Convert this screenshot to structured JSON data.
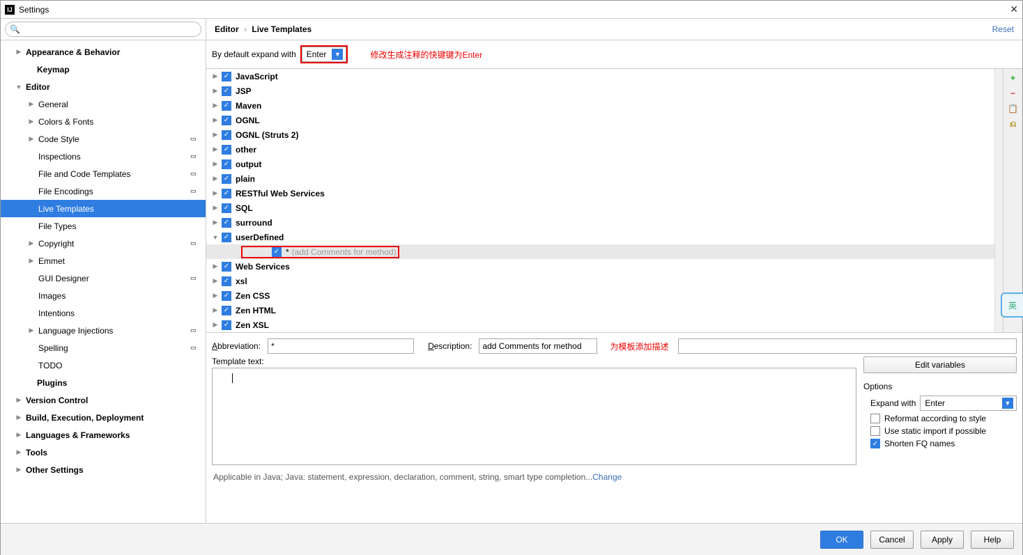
{
  "window": {
    "title": "Settings",
    "close": "✕"
  },
  "search": {
    "placeholder": ""
  },
  "breadcrumb": {
    "a": "Editor",
    "b": "Live Templates",
    "reset": "Reset"
  },
  "sidebar": [
    {
      "lbl": "Appearance & Behavior",
      "ind": 16,
      "arr": "▶",
      "b": 1
    },
    {
      "lbl": "Keymap",
      "ind": 32,
      "noarr": 1,
      "b": 1
    },
    {
      "lbl": "Editor",
      "ind": 16,
      "arr": "▼",
      "b": 1
    },
    {
      "lbl": "General",
      "ind": 34,
      "arr": "▶"
    },
    {
      "lbl": "Colors & Fonts",
      "ind": 34,
      "arr": "▶"
    },
    {
      "lbl": "Code Style",
      "ind": 34,
      "arr": "▶",
      "tag": 1
    },
    {
      "lbl": "Inspections",
      "ind": 34,
      "noarr": 1,
      "tag": 1
    },
    {
      "lbl": "File and Code Templates",
      "ind": 34,
      "noarr": 1,
      "tag": 1
    },
    {
      "lbl": "File Encodings",
      "ind": 34,
      "noarr": 1,
      "tag": 1
    },
    {
      "lbl": "Live Templates",
      "ind": 34,
      "noarr": 1,
      "sel": 1
    },
    {
      "lbl": "File Types",
      "ind": 34,
      "noarr": 1
    },
    {
      "lbl": "Copyright",
      "ind": 34,
      "arr": "▶",
      "tag": 1
    },
    {
      "lbl": "Emmet",
      "ind": 34,
      "arr": "▶"
    },
    {
      "lbl": "GUI Designer",
      "ind": 34,
      "noarr": 1,
      "tag": 1
    },
    {
      "lbl": "Images",
      "ind": 34,
      "noarr": 1
    },
    {
      "lbl": "Intentions",
      "ind": 34,
      "noarr": 1
    },
    {
      "lbl": "Language Injections",
      "ind": 34,
      "arr": "▶",
      "tag": 1
    },
    {
      "lbl": "Spelling",
      "ind": 34,
      "noarr": 1,
      "tag": 1
    },
    {
      "lbl": "TODO",
      "ind": 34,
      "noarr": 1
    },
    {
      "lbl": "Plugins",
      "ind": 32,
      "noarr": 1,
      "b": 1
    },
    {
      "lbl": "Version Control",
      "ind": 16,
      "arr": "▶",
      "b": 1
    },
    {
      "lbl": "Build, Execution, Deployment",
      "ind": 16,
      "arr": "▶",
      "b": 1
    },
    {
      "lbl": "Languages & Frameworks",
      "ind": 16,
      "arr": "▶",
      "b": 1
    },
    {
      "lbl": "Tools",
      "ind": 16,
      "arr": "▶",
      "b": 1
    },
    {
      "lbl": "Other Settings",
      "ind": 16,
      "arr": "▶",
      "b": 1
    }
  ],
  "expand": {
    "label": "By default expand with",
    "value": "Enter",
    "anno": "修改生成注释的快键键为Enter"
  },
  "tree": [
    {
      "lbl": "JavaScript",
      "arr": "▶"
    },
    {
      "lbl": "JSP",
      "arr": "▶"
    },
    {
      "lbl": "Maven",
      "arr": "▶"
    },
    {
      "lbl": "OGNL",
      "arr": "▶"
    },
    {
      "lbl": "OGNL (Struts 2)",
      "arr": "▶"
    },
    {
      "lbl": "other",
      "arr": "▶"
    },
    {
      "lbl": "output",
      "arr": "▶"
    },
    {
      "lbl": "plain",
      "arr": "▶"
    },
    {
      "lbl": "RESTful Web Services",
      "arr": "▶"
    },
    {
      "lbl": "SQL",
      "arr": "▶"
    },
    {
      "lbl": "surround",
      "arr": "▶"
    },
    {
      "lbl": "userDefined",
      "arr": "▼"
    },
    {
      "lbl": "*",
      "desc": "(add Comments for method)",
      "sub": 1,
      "sel": 1,
      "red": 1
    },
    {
      "lbl": "Web Services",
      "arr": "▶"
    },
    {
      "lbl": "xsl",
      "arr": "▶"
    },
    {
      "lbl": "Zen CSS",
      "arr": "▶"
    },
    {
      "lbl": "Zen HTML",
      "arr": "▶"
    },
    {
      "lbl": "Zen XSL",
      "arr": "▶"
    }
  ],
  "gutter": {
    "add": "+",
    "remove": "−",
    "copy": "📋",
    "restore": "⎌"
  },
  "form": {
    "abbr_lbl": "Abbreviation:",
    "abbr_val": "*",
    "desc_lbl": "Description:",
    "desc_val": "add Comments for method",
    "anno": "为模板添加描述",
    "tt_lbl": "Template text:",
    "editvars": "Edit variables",
    "opts_title": "Options",
    "expand_lbl": "Expand with",
    "expand_val": "Enter",
    "reformat": "Reformat according to style",
    "static": "Use static import if possible",
    "shorten": "Shorten FQ names"
  },
  "applic": {
    "text": "Applicable in Java; Java: statement, expression, declaration, comment, string, smart type completion...",
    "change": "Change"
  },
  "footer": {
    "ok": "OK",
    "cancel": "Cancel",
    "apply": "Apply",
    "help": "Help"
  },
  "ime": "英"
}
